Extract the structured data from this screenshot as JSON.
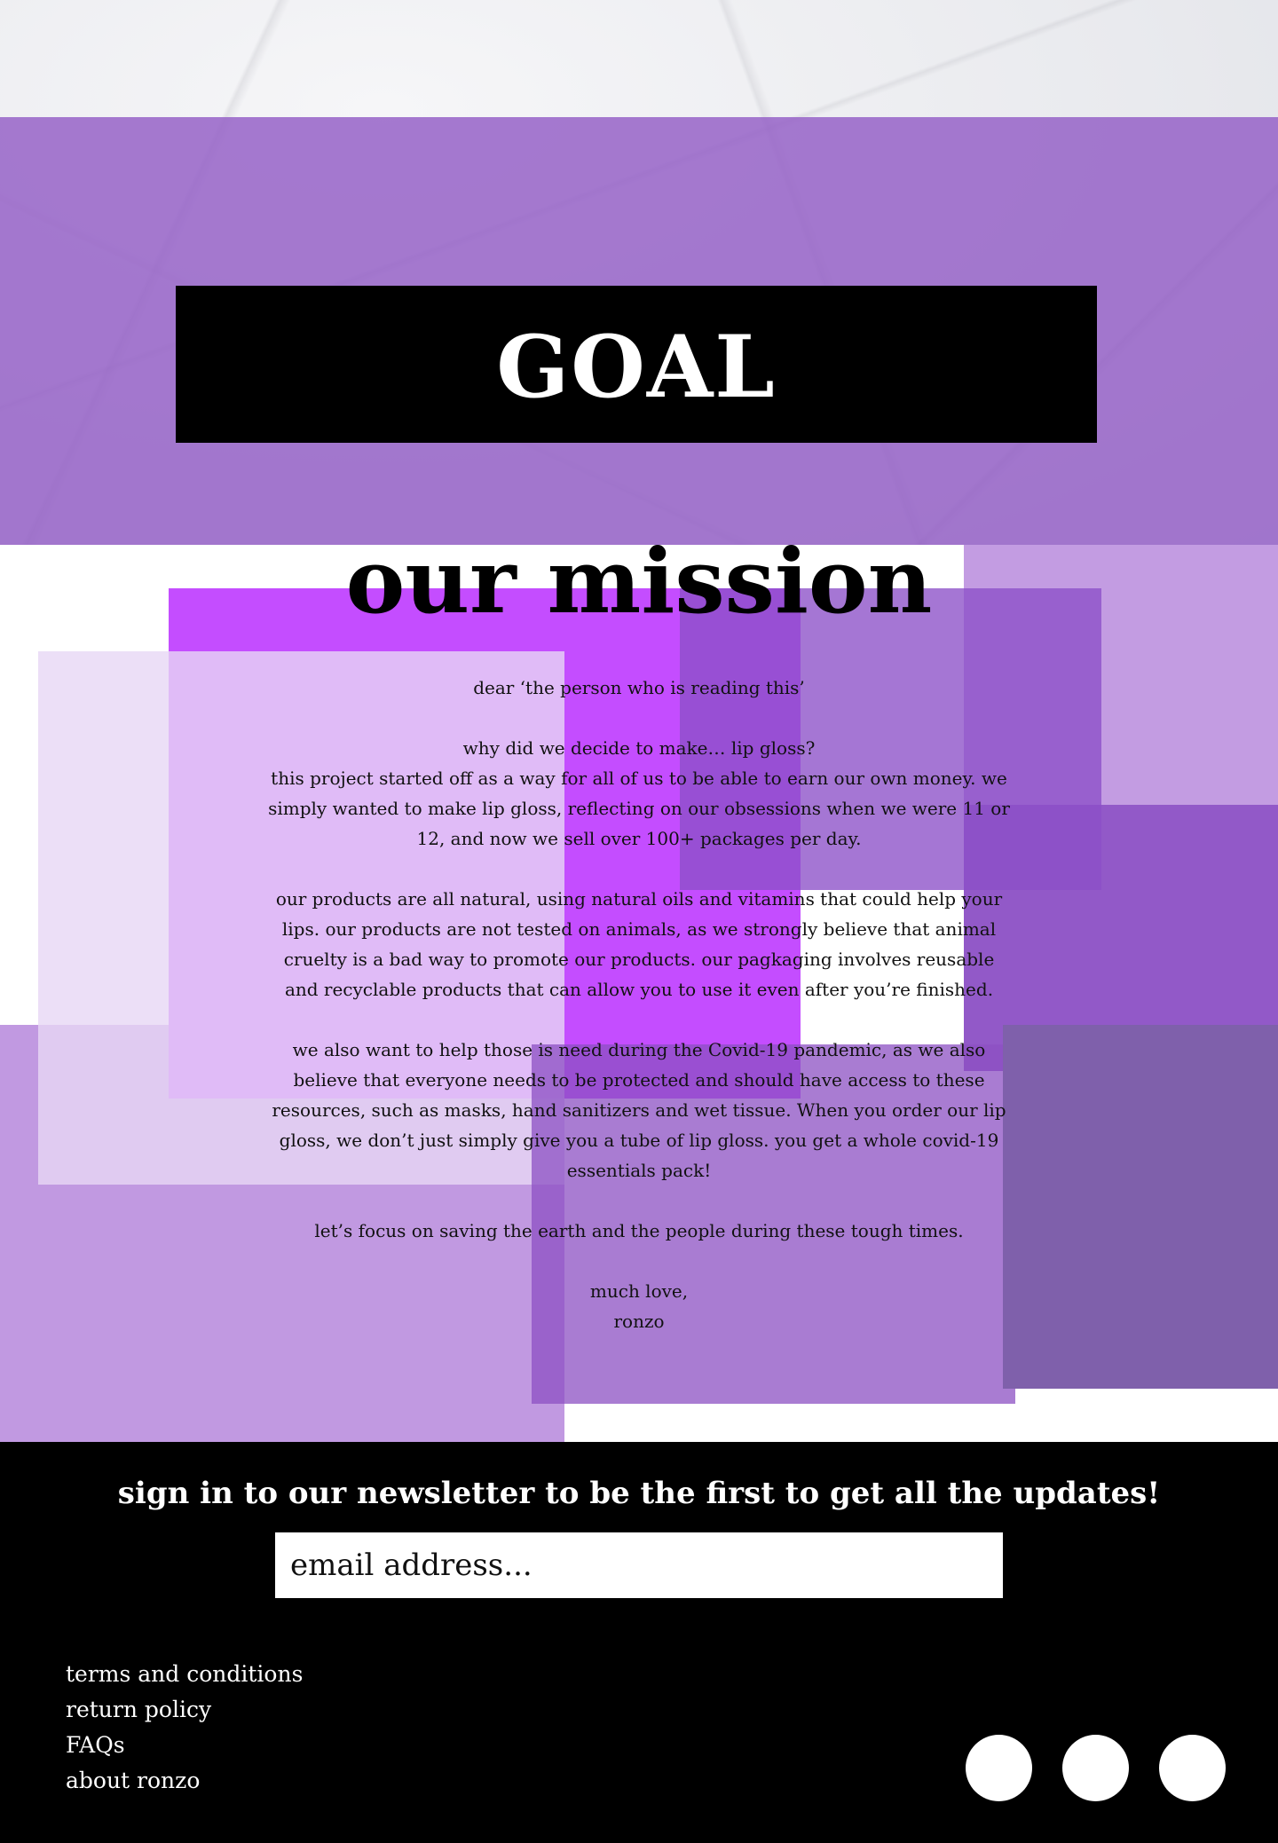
{
  "hero": {
    "title": "GOAL"
  },
  "mission": {
    "title": "our mission",
    "letter": {
      "greeting": "dear ‘the person who is reading this’",
      "question": "why did we decide to make… lip gloss?",
      "para1": "this project started off as a way for all of us to be able to earn our own money. we simply wanted to make lip gloss, reflecting on our obsessions when we were 11 or 12, and now we sell over 100+ packages per day.",
      "para2": "our products are all natural, using natural oils and vitamins that could help your lips. our products are not tested on animals, as we strongly believe that animal cruelty is a bad way to promote our products. our pagkaging involves reusable and recyclable products that can allow you to use it even after you’re finished.",
      "para3": "we also want to help those is need during the Covid-19 pandemic, as we also believe that everyone needs to be protected and should have access to these resources, such as masks, hand sanitizers and wet tissue. When you order our lip gloss, we don’t just simply give you a tube of lip gloss. you get a whole covid-19 essentials pack!",
      "para4": "let’s focus on saving the earth and the people during these tough times.",
      "signoff": "much love,",
      "signature": "ronzo"
    }
  },
  "footer": {
    "newsletter_heading": "sign in to our newsletter to be the first to get all the updates!",
    "email_placeholder": "email address...",
    "links": [
      "terms and conditions",
      "return policy",
      "FAQs",
      "about ronzo"
    ],
    "social_icons": [
      "social-icon-1",
      "social-icon-2",
      "social-icon-3"
    ]
  },
  "colors": {
    "hero_overlay": "#935dc6",
    "accent_magenta": "#c44dff",
    "lavender": "#c39ce2",
    "footer_bg": "#000000"
  }
}
